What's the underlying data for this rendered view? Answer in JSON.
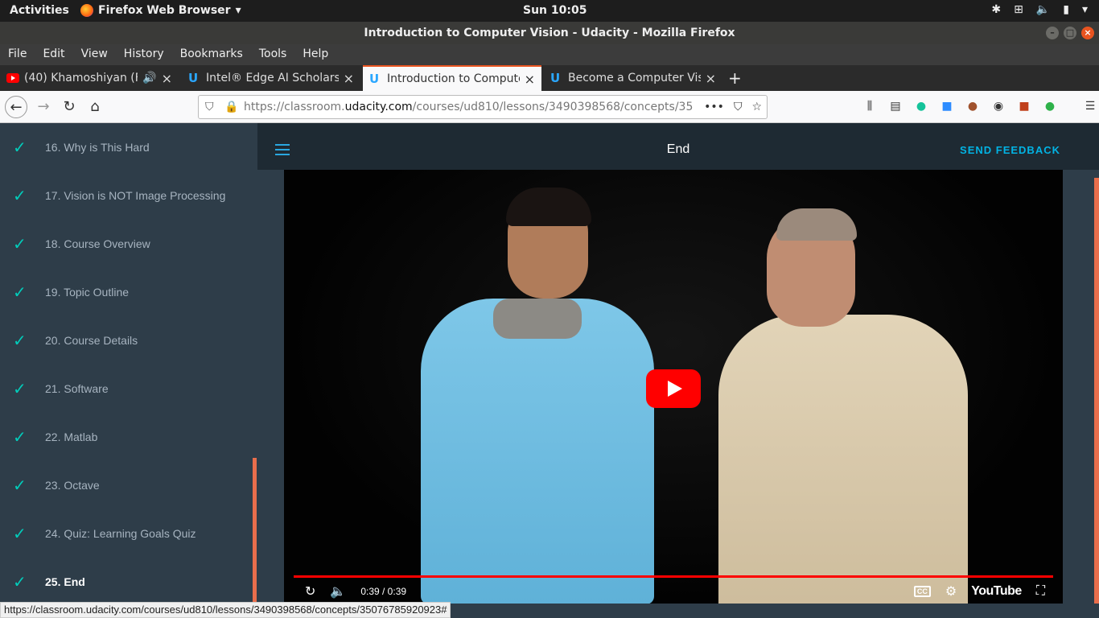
{
  "system": {
    "activities": "Activities",
    "app_name": "Firefox Web Browser",
    "clock": "Sun 10:05"
  },
  "window": {
    "title": "Introduction to Computer Vision - Udacity - Mozilla Firefox"
  },
  "menu": [
    "File",
    "Edit",
    "View",
    "History",
    "Bookmarks",
    "Tools",
    "Help"
  ],
  "tabs": [
    {
      "title": "(40) Khamoshiyan (Fro",
      "icon": "youtube-icon"
    },
    {
      "title": "Intel® Edge AI Scholarsh",
      "icon": "udacity-icon"
    },
    {
      "title": "Introduction to Compute",
      "icon": "udacity-icon",
      "active": true
    },
    {
      "title": "Become a Computer Visi",
      "icon": "udacity-icon"
    }
  ],
  "url": {
    "prefix": "https://classroom.",
    "domain": "udacity.com",
    "path": "/courses/ud810/lessons/3490398568/concepts/35",
    "more": "•••"
  },
  "sidebar": {
    "items": [
      "16. Why is This Hard",
      "17. Vision is NOT Image Processing",
      "18. Course Overview",
      "19. Topic Outline",
      "20. Course Details",
      "21. Software",
      "22. Matlab",
      "23. Octave",
      "24. Quiz: Learning Goals Quiz",
      "25. End"
    ],
    "current_index": 9
  },
  "main": {
    "title": "End",
    "feedback": "SEND FEEDBACK"
  },
  "video": {
    "time": "0:39 / 0:39",
    "progress": 1.0,
    "brand": "YouTube",
    "cc": "CC"
  },
  "status_url": "https://classroom.udacity.com/courses/ud810/lessons/3490398568/concepts/35076785920923#",
  "colors": {
    "accent": "#02ccba",
    "link": "#02b3e4",
    "scroll": "#e96e4c",
    "tab_accent": "#e95420"
  }
}
